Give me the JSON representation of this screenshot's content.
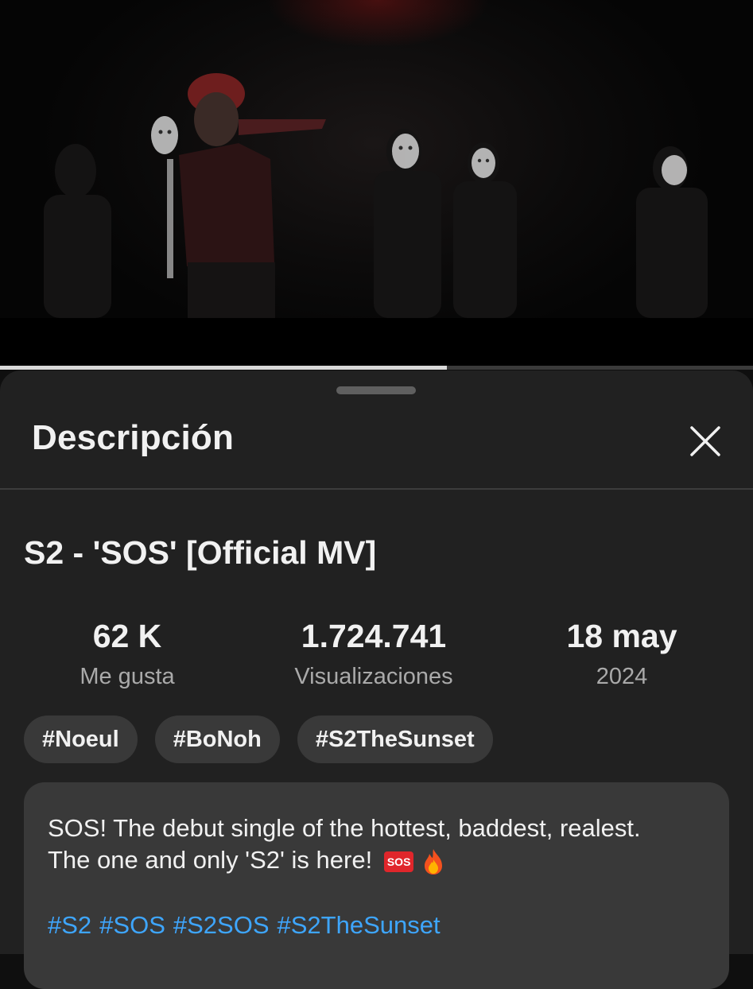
{
  "player": {
    "progress": 0.593
  },
  "sheet": {
    "title": "Descripción",
    "close_icon": "close-icon"
  },
  "video": {
    "title": "S2  - 'SOS' [Official MV]",
    "stats": {
      "likes_value": "62 K",
      "likes_label": "Me gusta",
      "views_value": "1.724.741",
      "views_label": "Visualizaciones",
      "date_value": "18 may",
      "date_label": "2024"
    },
    "tags": [
      "#Noeul",
      "#BoNoh",
      "#S2TheSunset"
    ]
  },
  "description": {
    "line1": "SOS! The debut single of the hottest, baddest, realest.",
    "line2": "The one and only 'S2' is here!",
    "sos_badge": "SOS",
    "fire_icon": "fire-emoji-icon",
    "hashtags": [
      "#S2",
      "#SOS",
      "#S2SOS",
      "#S2TheSunset"
    ]
  },
  "colors": {
    "accent_link": "#3ea6ff",
    "sos_red": "#e0262b",
    "chip_bg": "#393939",
    "sheet_bg": "#212121"
  }
}
